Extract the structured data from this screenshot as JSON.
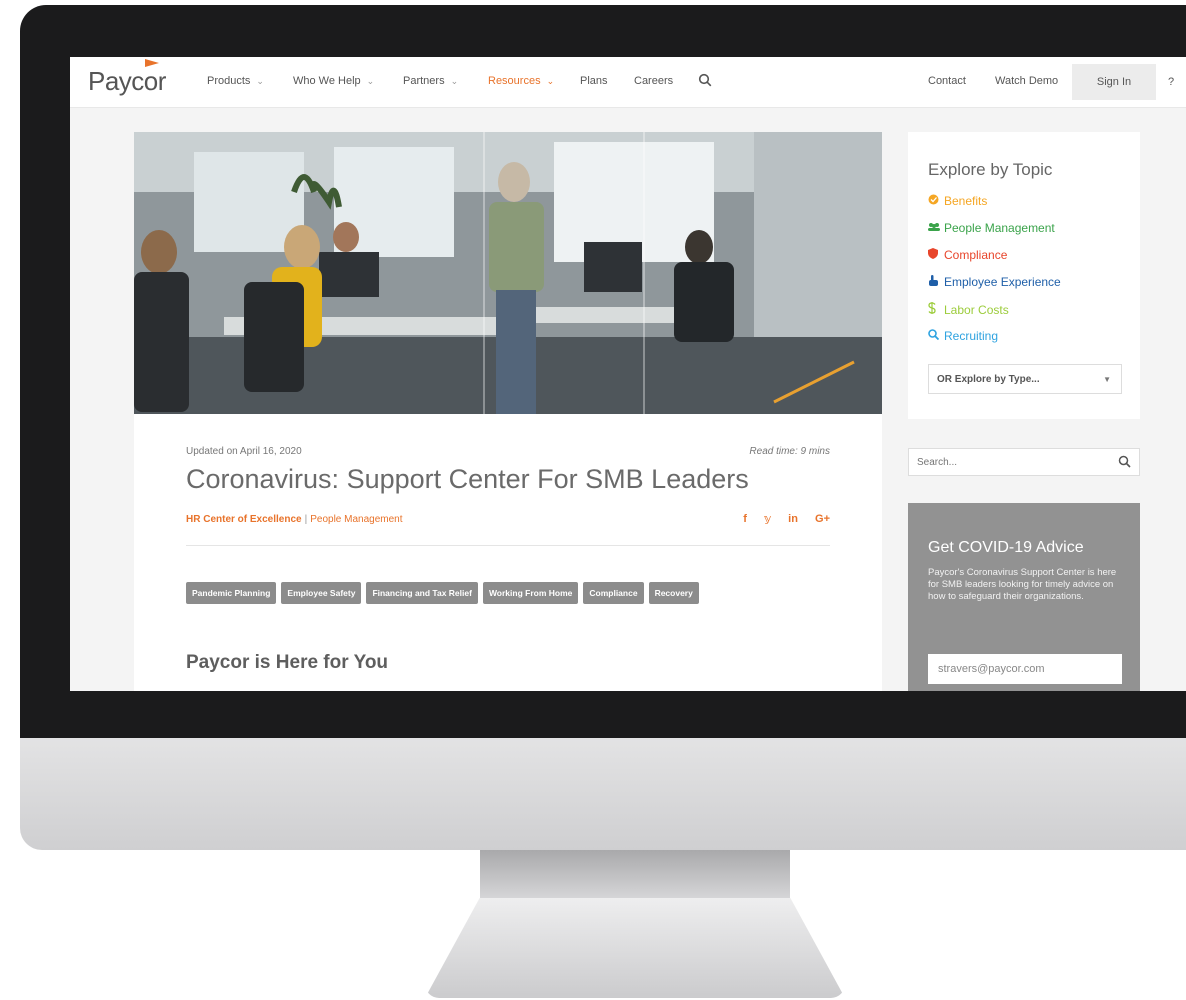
{
  "brand": {
    "logo": "Paycor",
    "accent": "#e8732b"
  },
  "nav": {
    "items": [
      {
        "label": "Products",
        "caret": "⌄"
      },
      {
        "label": "Who We Help",
        "caret": "⌄"
      },
      {
        "label": "Partners",
        "caret": "⌄"
      },
      {
        "label": "Resources",
        "caret": "⌄"
      },
      {
        "label": "Plans"
      },
      {
        "label": "Careers"
      }
    ],
    "right": {
      "contact": "Contact",
      "watch_demo": "Watch Demo",
      "sign_in": "Sign In",
      "help": "?"
    }
  },
  "article": {
    "updated": "Updated on April 16, 2020",
    "read_time": "Read time: 9 mins",
    "title": "Coronavirus: Support Center For SMB Leaders",
    "category_primary": "HR Center of Excellence",
    "category_sep": "|",
    "category_secondary": "People Management",
    "social": {
      "facebook": "f",
      "twitter": "𝕪",
      "linkedin": "in",
      "google": "G+"
    },
    "tags": [
      "Pandemic Planning",
      "Employee Safety",
      "Financing and Tax Relief",
      "Working From Home",
      "Compliance",
      "Recovery"
    ],
    "subheading": "Paycor is Here for You"
  },
  "sidebar": {
    "explore_title": "Explore by Topic",
    "topics": [
      {
        "label": "Benefits",
        "color": "#f5a623",
        "icon": "benefits-icon"
      },
      {
        "label": "People Management",
        "color": "#3aa34a",
        "icon": "people-icon"
      },
      {
        "label": "Compliance",
        "color": "#e8452b",
        "icon": "shield-icon"
      },
      {
        "label": "Employee Experience",
        "color": "#1f5fa8",
        "icon": "hand-icon"
      },
      {
        "label": "Labor Costs",
        "color": "#9ccc3b",
        "icon": "dollar-icon"
      },
      {
        "label": "Recruiting",
        "color": "#2fa3e0",
        "icon": "magnifier-icon"
      }
    ],
    "type_select": "OR Explore by Type...",
    "search_placeholder": "Search...",
    "advice": {
      "title": "Get COVID-19 Advice",
      "text": "Paycor's Coronavirus Support Center is here for SMB leaders looking for timely advice on how to safeguard their organizations.",
      "email_value": "stravers@paycor.com"
    }
  }
}
